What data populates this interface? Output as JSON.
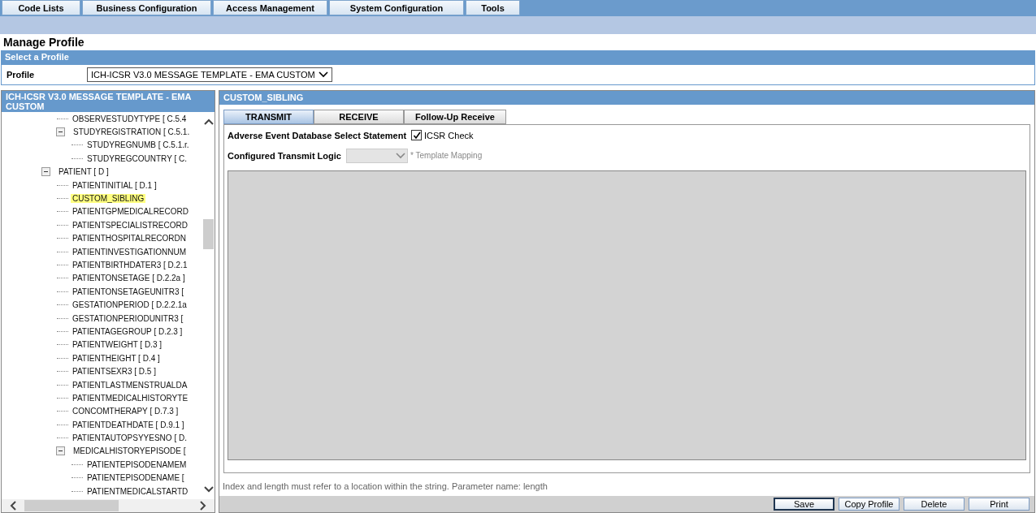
{
  "menu": [
    {
      "label": "Code Lists"
    },
    {
      "label": "Business Configuration"
    },
    {
      "label": "Access Management"
    },
    {
      "label": "System Configuration"
    },
    {
      "label": "Tools"
    }
  ],
  "page_title": "Manage Profile",
  "profile_section": {
    "title": "Select a Profile",
    "label": "Profile",
    "value": "ICH-ICSR V3.0 MESSAGE TEMPLATE - EMA CUSTOM"
  },
  "tree": {
    "title": "ICH-ICSR V3.0 MESSAGE TEMPLATE - EMA CUSTOM",
    "continued_items": [
      {
        "label": "OBSERVESTUDYTYPE [ C.5.4",
        "selected": false
      },
      {
        "label": "STUDYREGISTRATION [ C.5.1.",
        "selected": false,
        "expanded": true,
        "children": [
          {
            "label": "STUDYREGNUMB [ C.5.1.r.",
            "selected": false
          },
          {
            "label": "STUDYREGCOUNTRY [ C.",
            "selected": false
          }
        ]
      }
    ],
    "items": [
      {
        "label": "PATIENT [ D ]",
        "selected": false,
        "expanded": true,
        "children": [
          {
            "label": "PATIENTINITIAL [ D.1 ]",
            "selected": false
          },
          {
            "label": "CUSTOM_SIBLING",
            "selected": true
          },
          {
            "label": "PATIENTGPMEDICALRECORD",
            "selected": false
          },
          {
            "label": "PATIENTSPECIALISTRECORD",
            "selected": false
          },
          {
            "label": "PATIENTHOSPITALRECORDN",
            "selected": false
          },
          {
            "label": "PATIENTINVESTIGATIONNUM",
            "selected": false
          },
          {
            "label": "PATIENTBIRTHDATER3 [ D.2.1",
            "selected": false
          },
          {
            "label": "PATIENTONSETAGE [ D.2.2a ]",
            "selected": false
          },
          {
            "label": "PATIENTONSETAGEUNITR3 [",
            "selected": false
          },
          {
            "label": "GESTATIONPERIOD [ D.2.2.1a",
            "selected": false
          },
          {
            "label": "GESTATIONPERIODUNITR3 [",
            "selected": false
          },
          {
            "label": "PATIENTAGEGROUP [ D.2.3 ]",
            "selected": false
          },
          {
            "label": "PATIENTWEIGHT [ D.3 ]",
            "selected": false
          },
          {
            "label": "PATIENTHEIGHT [ D.4 ]",
            "selected": false
          },
          {
            "label": "PATIENTSEXR3 [ D.5 ]",
            "selected": false
          },
          {
            "label": "PATIENTLASTMENSTRUALDA",
            "selected": false
          },
          {
            "label": "PATIENTMEDICALHISTORYTE",
            "selected": false
          },
          {
            "label": "CONCOMTHERAPY [ D.7.3 ]",
            "selected": false
          },
          {
            "label": "PATIENTDEATHDATE [ D.9.1 ]",
            "selected": false
          },
          {
            "label": "PATIENTAUTOPSYYESNO [ D.",
            "selected": false
          },
          {
            "label": "MEDICALHISTORYEPISODE [",
            "selected": false,
            "expanded": true,
            "children": [
              {
                "label": "PATIENTEPISODENAMEM",
                "selected": false
              },
              {
                "label": "PATIENTEPISODENAME [",
                "selected": false
              },
              {
                "label": "PATIENTMEDICALSTARTD",
                "selected": false
              }
            ]
          }
        ]
      }
    ]
  },
  "detail": {
    "title": "CUSTOM_SIBLING",
    "tabs": [
      {
        "label": "TRANSMIT",
        "selected": true
      },
      {
        "label": "RECEIVE",
        "selected": false
      },
      {
        "label": "Follow-Up Receive",
        "selected": false
      }
    ],
    "select_statement_label": "Adverse Event Database Select Statement",
    "icsr_check": {
      "label": "ICSR Check",
      "checked": true
    },
    "transmit_logic": {
      "label": "Configured Transmit Logic",
      "disabled": true,
      "note": "* Template Mapping"
    },
    "error_message": "Index and length must refer to a location within the string. Parameter name: length",
    "buttons": [
      {
        "label": "Save"
      },
      {
        "label": "Copy Profile"
      },
      {
        "label": "Delete"
      },
      {
        "label": "Print"
      }
    ]
  }
}
